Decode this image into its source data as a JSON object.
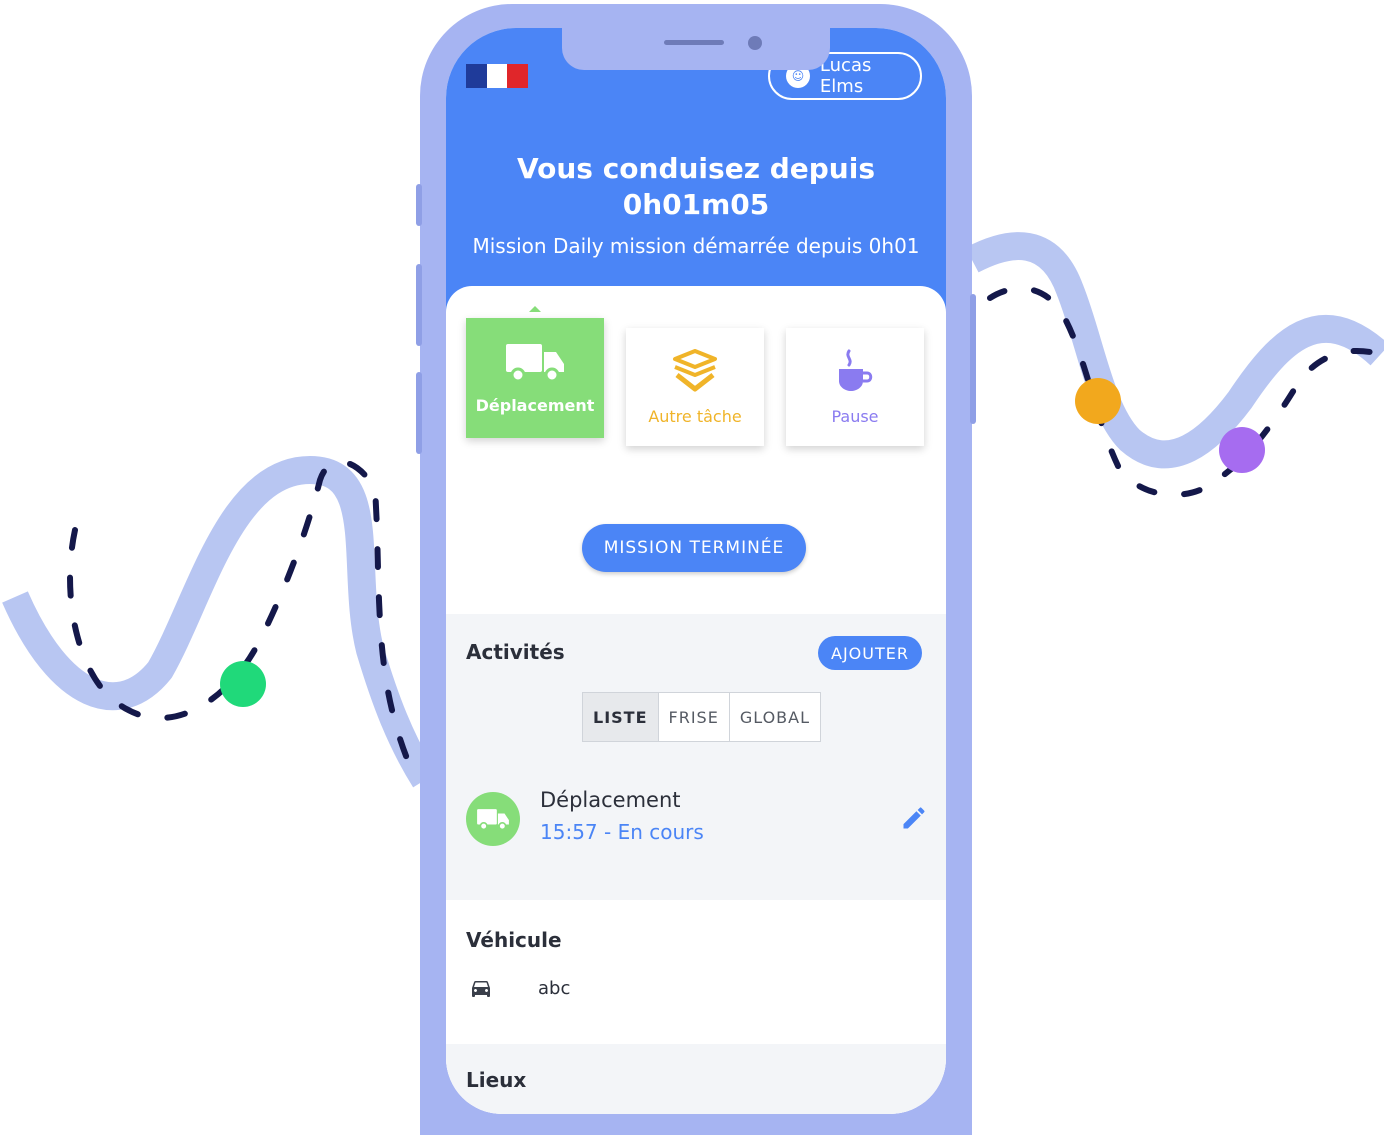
{
  "user": {
    "name": "Lucas Elms"
  },
  "header": {
    "title_line1": "Vous conduisez depuis",
    "title_line2": "0h01m05",
    "subtitle": "Mission Daily mission démarrée depuis 0h01"
  },
  "activity_types": [
    {
      "label": "Déplacement",
      "icon": "truck-icon",
      "active": true
    },
    {
      "label": "Autre tâche",
      "icon": "box-icon",
      "active": false
    },
    {
      "label": "Pause",
      "icon": "coffee-icon",
      "active": false
    }
  ],
  "end_mission_label": "MISSION TERMINÉE",
  "activities": {
    "title": "Activités",
    "add_label": "AJOUTER",
    "tabs": [
      {
        "label": "LISTE",
        "active": true
      },
      {
        "label": "FRISE",
        "active": false
      },
      {
        "label": "GLOBAL",
        "active": false
      }
    ],
    "items": [
      {
        "name": "Déplacement",
        "time": "15:57 - En cours",
        "icon": "truck-icon"
      }
    ]
  },
  "vehicle": {
    "title": "Véhicule",
    "value": "abc",
    "icon": "car-icon"
  },
  "places": {
    "title": "Lieux"
  },
  "colors": {
    "primary": "#4b85f6",
    "driving": "#86dd79",
    "other_task": "#f0b429",
    "pause": "#8a7bf0",
    "phone_frame": "#a6b4f2",
    "decor_green": "#20d97a",
    "decor_orange": "#f2a81d",
    "decor_purple": "#a66cf0",
    "decor_dash": "#14184a"
  }
}
